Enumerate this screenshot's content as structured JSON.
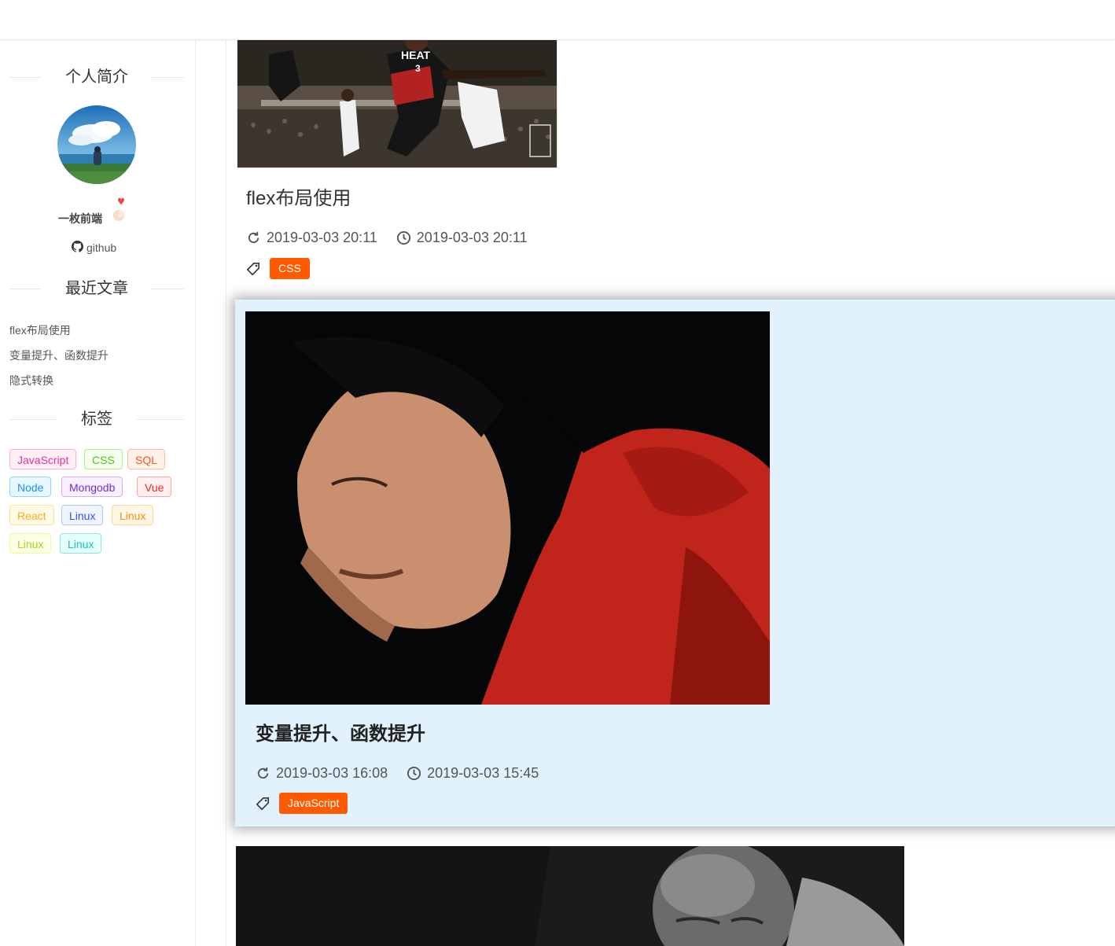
{
  "sidebar": {
    "profile_title": "个人简介",
    "author_name": "一枚前端",
    "github_label": "github",
    "recent_title": "最近文章",
    "recent_posts": [
      "flex布局使用",
      "变量提升、函数提升",
      "隐式转换"
    ],
    "tags_title": "标签",
    "tags": [
      {
        "label": "JavaScript",
        "color": "#eb2f96",
        "bg": "#fff0f6",
        "border": "#ffadd2"
      },
      {
        "label": "CSS",
        "color": "#52c41a",
        "bg": "#f6ffed",
        "border": "#b7eb8f"
      },
      {
        "label": "SQL",
        "color": "#fa541c",
        "bg": "#fff2e8",
        "border": "#ffbb96"
      },
      {
        "label": "Node",
        "color": "#1890ff",
        "bg": "#e6f7ff",
        "border": "#91d5ff"
      },
      {
        "label": "Mongodb",
        "color": "#722ed1",
        "bg": "#f9f0ff",
        "border": "#d3adf7"
      },
      {
        "label": "Vue",
        "color": "#f5222d",
        "bg": "#fff1f0",
        "border": "#ffa39e"
      },
      {
        "label": "React",
        "color": "#faad14",
        "bg": "#fffbe6",
        "border": "#ffe58f"
      },
      {
        "label": "Linux",
        "color": "#2f54eb",
        "bg": "#f0f5ff",
        "border": "#adc6ff"
      },
      {
        "label": "Linux",
        "color": "#fa8c16",
        "bg": "#fff7e6",
        "border": "#ffd591"
      },
      {
        "label": "Linux",
        "color": "#a0d911",
        "bg": "#fcffe6",
        "border": "#eaff8f"
      },
      {
        "label": "Linux",
        "color": "#13c2c2",
        "bg": "#e6fffb",
        "border": "#87e8de"
      }
    ]
  },
  "articles": [
    {
      "title": "flex布局使用",
      "updated": "2019-03-03 20:11",
      "created": "2019-03-03 20:11",
      "tag": "CSS"
    },
    {
      "title": "变量提升、函数提升",
      "updated": "2019-03-03 16:08",
      "created": "2019-03-03 15:45",
      "tag": "JavaScript"
    }
  ],
  "colors": {
    "accent": "#ff5a00",
    "highlight_card_bg": "#e1f2fd"
  },
  "icons": {
    "update": "refresh-icon",
    "create": "clock-icon",
    "tag": "tag-icon",
    "github": "github-icon"
  }
}
